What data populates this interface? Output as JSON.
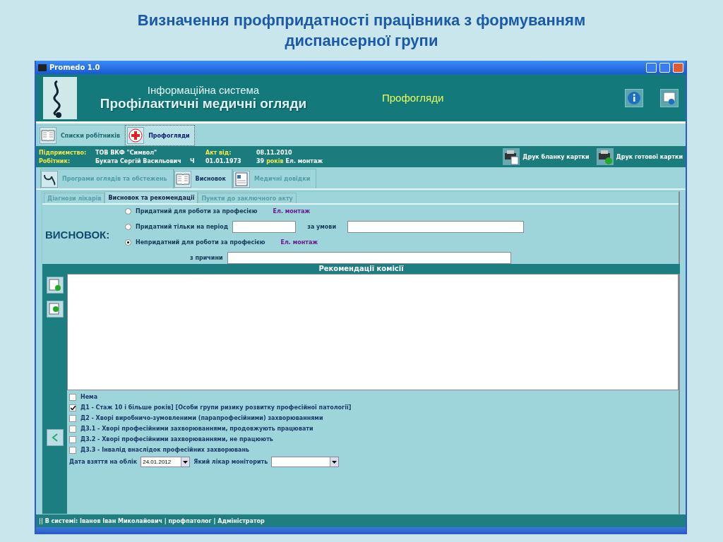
{
  "slide_title": "Визначення профпридатності працівника з формуванням диспансерної групи",
  "window": {
    "title": "Promedo 1.0"
  },
  "banner": {
    "subtitle": "Інформаційна система",
    "title": "Профілактичні медичні огляди",
    "section": "Профогляди"
  },
  "main_tabs": [
    {
      "label": "Списки робітників",
      "selected": false,
      "kind": "book"
    },
    {
      "label": "Профогляди",
      "selected": true,
      "kind": "cross"
    }
  ],
  "info": {
    "enterprise_label": "Підприємство:",
    "enterprise": "ТОВ ВКФ \"Символ\"",
    "act_label": "Акт від:",
    "act_date": "08.11.2010",
    "worker_label": "Робітник:",
    "worker": "Буката Сергій Васильович",
    "sex": "Ч",
    "birth": "01.01.1973",
    "age": "39",
    "age_unit": "років",
    "profession": "Ел. монтаж"
  },
  "print_buttons": [
    {
      "label": "Друк бланку картки",
      "kind": "blank"
    },
    {
      "label": "Друк готової картки",
      "kind": "ready"
    }
  ],
  "section_tabs": [
    {
      "label": "Програми оглядів та обстежень",
      "selected": false,
      "kind": "stethoscope"
    },
    {
      "label": "Висновок",
      "selected": true,
      "kind": "book"
    },
    {
      "label": "Медичні довідки",
      "selected": false,
      "kind": "doc"
    }
  ],
  "sub_tabs": [
    {
      "label": "Діагнози лікарів",
      "selected": false
    },
    {
      "label": "Висновок та рекомендації",
      "selected": true
    },
    {
      "label": "Пункти до заключного акту",
      "selected": false
    }
  ],
  "conclusion": {
    "heading": "ВИСНОВОК:",
    "options": [
      {
        "label": "Придатний для роботи за професією",
        "selected": false,
        "kind": "profession",
        "profession": "Ел. монтаж"
      },
      {
        "label": "Придатний тільки на період",
        "selected": false,
        "kind": "period",
        "condition_label": "за умови"
      },
      {
        "label": "Непридатний для роботи за професією",
        "selected": true,
        "kind": "profession",
        "profession": "Ел. монтаж"
      }
    ],
    "reason_label": "з причини"
  },
  "recommendations": {
    "title": "Рекомендації комісії"
  },
  "groups": [
    {
      "label": "Нема",
      "checked": false
    },
    {
      "label": "Д1 - Стаж 10 і більше років] [Особи групи ризику розвитку професійної патології]",
      "checked": true
    },
    {
      "label": "Д2 - Хворі виробничо-зумовленими (парапрофесійними) захворюваннями",
      "checked": false
    },
    {
      "label": "Д3.1 - Хворі професійними захворюваннями, продовжують працювати",
      "checked": false
    },
    {
      "label": "Д3.2 - Хворі професійними захворюваннями, не працюють",
      "checked": false
    },
    {
      "label": "Д3.3 - Інвалід внаслідок професійних захворювань",
      "checked": false
    }
  ],
  "registration": {
    "date_label": "Дата взяття на облік",
    "date": "24.01.2012",
    "doctor_label": "Який лікар моніторить"
  },
  "status_bar": "|| В системі: Іванов Іван Миколайович | профпатолог | Адміністратор"
}
